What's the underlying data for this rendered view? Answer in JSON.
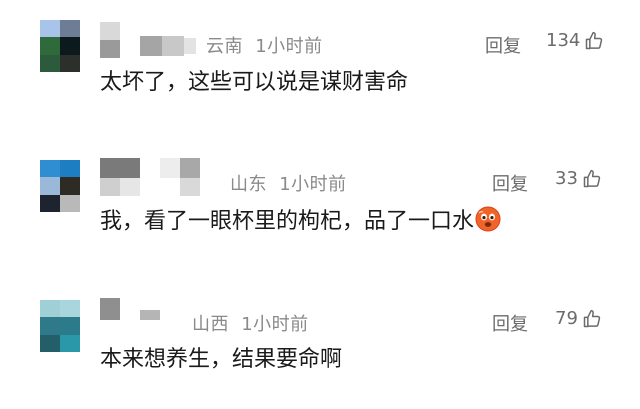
{
  "comments": [
    {
      "location": "云南",
      "time": "1小时前",
      "reply_label": "回复",
      "likes": "134",
      "text": "太坏了，这些可以说是谋财害命"
    },
    {
      "location": "山东",
      "time": "1小时前",
      "reply_label": "回复",
      "likes": "33",
      "text": "我，看了一眼杯里的枸杞，品了一口水",
      "emoji": "heat-face-emoji"
    },
    {
      "location": "山西",
      "time": "1小时前",
      "reply_label": "回复",
      "likes": "79",
      "text": "本来想养生，结果要命啊"
    }
  ],
  "icons": {
    "like": "thumbs-up-icon"
  },
  "colors": {
    "meta": "#8a8a8a",
    "body_text": "#1a1a1a",
    "emoji": "#f0642a"
  }
}
